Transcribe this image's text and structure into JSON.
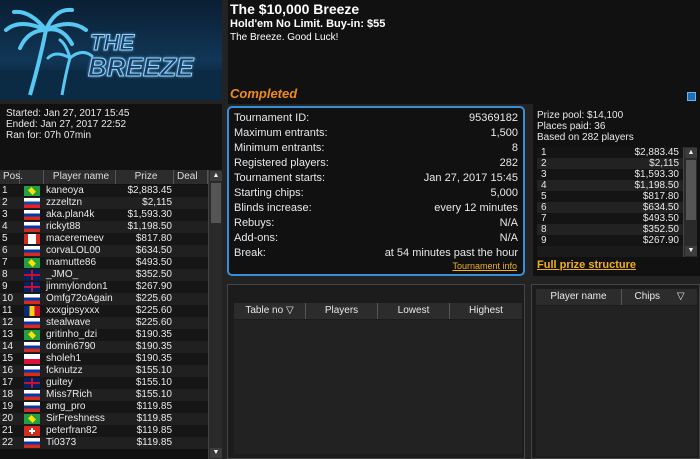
{
  "header": {
    "tournament_name": "The $10,000 Breeze",
    "game_info": "Hold'em No Limit. Buy-in: $55",
    "tagline": "The Breeze. Good Luck!",
    "status": "Completed",
    "logo_text_1": "THE",
    "logo_text_2": "BREEZE"
  },
  "times": {
    "started": "Started: Jan 27, 2017 15:45",
    "ended": "Ended: Jan 27, 2017 22:52",
    "ran_for": "Ran for: 07h 07min"
  },
  "players_table": {
    "headers": [
      "Pos.",
      "",
      "Player name",
      "Prize",
      "Deal"
    ],
    "rows": [
      {
        "pos": "1",
        "flag": "br",
        "name": "kaneoya",
        "prize": "$2,883.45"
      },
      {
        "pos": "2",
        "flag": "sk",
        "name": "zzzeltzn",
        "prize": "$2,115"
      },
      {
        "pos": "3",
        "flag": "ru",
        "name": "aka.plan4k",
        "prize": "$1,593.30"
      },
      {
        "pos": "4",
        "flag": "ru",
        "name": "rickyt88",
        "prize": "$1,198.50"
      },
      {
        "pos": "5",
        "flag": "ca",
        "name": "maceremeev",
        "prize": "$817.80"
      },
      {
        "pos": "6",
        "flag": "ru",
        "name": "corvaLOL00",
        "prize": "$634.50"
      },
      {
        "pos": "7",
        "flag": "br",
        "name": "mamutte86",
        "prize": "$493.50"
      },
      {
        "pos": "8",
        "flag": "gb",
        "name": "_JMO_",
        "prize": "$352.50"
      },
      {
        "pos": "9",
        "flag": "gb",
        "name": "jimmylondon1",
        "prize": "$267.90"
      },
      {
        "pos": "10",
        "flag": "ru",
        "name": "Omfg72oAgain",
        "prize": "$225.60"
      },
      {
        "pos": "11",
        "flag": "ro",
        "name": "xxxgipsyxxx",
        "prize": "$225.60"
      },
      {
        "pos": "12",
        "flag": "ru",
        "name": "stealwave",
        "prize": "$225.60"
      },
      {
        "pos": "13",
        "flag": "br",
        "name": "gritinho_dzi",
        "prize": "$190.35"
      },
      {
        "pos": "14",
        "flag": "ru",
        "name": "domin6790",
        "prize": "$190.35"
      },
      {
        "pos": "15",
        "flag": "pl",
        "name": "sholeh1",
        "prize": "$190.35"
      },
      {
        "pos": "16",
        "flag": "ru",
        "name": "fcknutzz",
        "prize": "$155.10"
      },
      {
        "pos": "17",
        "flag": "gb",
        "name": "guitey",
        "prize": "$155.10"
      },
      {
        "pos": "18",
        "flag": "ru",
        "name": "Miss7Rich",
        "prize": "$155.10"
      },
      {
        "pos": "19",
        "flag": "ru",
        "name": "amg_pro",
        "prize": "$119.85"
      },
      {
        "pos": "20",
        "flag": "br",
        "name": "SirFreshness",
        "prize": "$119.85"
      },
      {
        "pos": "21",
        "flag": "ch",
        "name": "peterfran82",
        "prize": "$119.85"
      },
      {
        "pos": "22",
        "flag": "ru",
        "name": "Ti0373",
        "prize": "$119.85"
      }
    ]
  },
  "tournament_info": {
    "rows": [
      {
        "label": "Tournament ID:",
        "value": "95369182"
      },
      {
        "label": "Maximum entrants:",
        "value": "1,500"
      },
      {
        "label": "Minimum entrants:",
        "value": "8"
      },
      {
        "label": "Registered players:",
        "value": "282"
      },
      {
        "label": "Tournament starts:",
        "value": "Jan 27, 2017 15:45"
      },
      {
        "label": "Starting chips:",
        "value": "5,000"
      },
      {
        "label": "Blinds increase:",
        "value": "every 12 minutes"
      },
      {
        "label": "Rebuys:",
        "value": "N/A"
      },
      {
        "label": "Add-ons:",
        "value": "N/A"
      },
      {
        "label": "Break:",
        "value": "at 54 minutes past the hour"
      }
    ],
    "link": "Tournament info"
  },
  "prize_info": {
    "pool": "Prize pool: $14,100",
    "places_paid": "Places paid: 36",
    "based_on": "Based on 282 players",
    "rows": [
      {
        "place": "1",
        "amount": "$2,883.45"
      },
      {
        "place": "2",
        "amount": "$2,115"
      },
      {
        "place": "3",
        "amount": "$1,593.30"
      },
      {
        "place": "4",
        "amount": "$1,198.50"
      },
      {
        "place": "5",
        "amount": "$817.80"
      },
      {
        "place": "6",
        "amount": "$634.50"
      },
      {
        "place": "7",
        "amount": "$493.50"
      },
      {
        "place": "8",
        "amount": "$352.50"
      },
      {
        "place": "9",
        "amount": "$267.90"
      }
    ],
    "full_link": "Full prize structure"
  },
  "tables_list": {
    "headers": [
      "Table no",
      "Players",
      "Lowest",
      "Highest"
    ]
  },
  "table_players": {
    "headers": [
      "Player name",
      "Chips"
    ]
  }
}
